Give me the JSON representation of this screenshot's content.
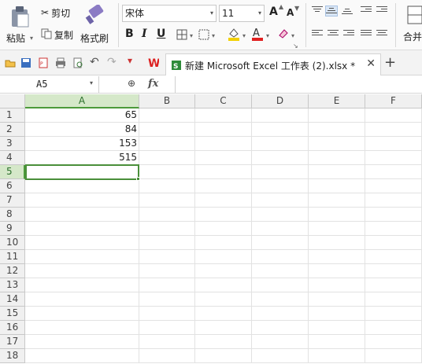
{
  "ribbon": {
    "paste_label": "粘贴",
    "cut_label": "剪切",
    "copy_label": "复制",
    "format_painter_label": "格式刷",
    "font_name": "宋体",
    "font_size": "11",
    "merge_label": "合并",
    "bold": "B",
    "italic": "I",
    "underline": "U",
    "grow_font": "A",
    "shrink_font": "A"
  },
  "doc_tab": {
    "title": "新建 Microsoft Excel 工作表 (2).xlsx *",
    "close": "✕",
    "add": "+"
  },
  "formula_bar": {
    "name_box": "A5",
    "fx_label": "fx",
    "value": ""
  },
  "sheet": {
    "columns": [
      "A",
      "B",
      "C",
      "D",
      "E",
      "F"
    ],
    "rows": [
      "1",
      "2",
      "3",
      "4",
      "5",
      "6",
      "7",
      "8",
      "9",
      "10",
      "11",
      "12",
      "13",
      "14",
      "15",
      "16",
      "17",
      "18"
    ],
    "selected_cell": "A5",
    "colA": [
      "65",
      "84",
      "153",
      "515"
    ]
  }
}
